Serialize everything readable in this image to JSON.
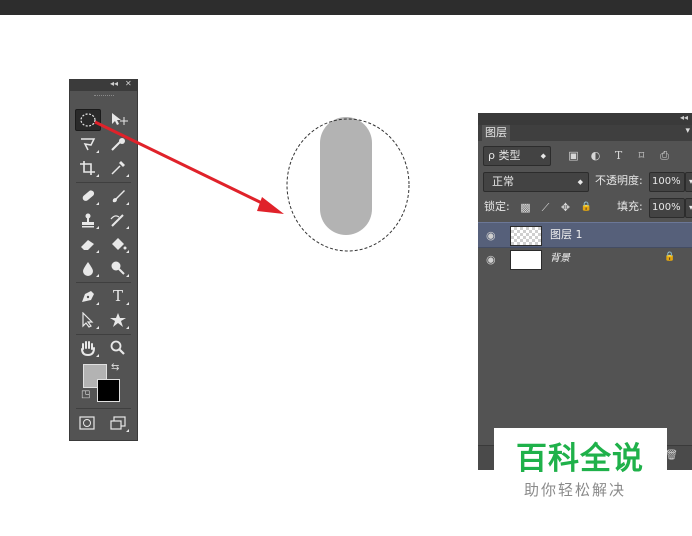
{
  "toolbox": {
    "collapse": "◂◂",
    "close": "✕",
    "tools": [
      {
        "name": "elliptical-marquee-tool",
        "glyph": "",
        "selected": true
      },
      {
        "name": "move-tool",
        "glyph": "▸✛"
      },
      {
        "name": "lasso-tool",
        "glyph": "ᗜ"
      },
      {
        "name": "quick-selection-tool",
        "glyph": "⟋"
      },
      {
        "name": "crop-tool",
        "glyph": "⌗"
      },
      {
        "name": "eyedropper-tool",
        "glyph": "⁄"
      },
      {
        "name": "healing-brush-tool",
        "glyph": "⌀"
      },
      {
        "name": "brush-tool",
        "glyph": "⟋"
      },
      {
        "name": "clone-stamp-tool",
        "glyph": "⊥"
      },
      {
        "name": "history-brush-tool",
        "glyph": "⤴"
      },
      {
        "name": "eraser-tool",
        "glyph": "▰"
      },
      {
        "name": "paint-bucket-tool",
        "glyph": "◆"
      },
      {
        "name": "blur-tool",
        "glyph": "●"
      },
      {
        "name": "dodge-tool",
        "glyph": "⚲"
      },
      {
        "name": "pen-tool",
        "glyph": "✒"
      },
      {
        "name": "type-tool",
        "glyph": "T"
      },
      {
        "name": "path-selection-tool",
        "glyph": "↖"
      },
      {
        "name": "shape-tool",
        "glyph": "✱"
      },
      {
        "name": "hand-tool",
        "glyph": "✋"
      },
      {
        "name": "zoom-tool",
        "glyph": "⚲"
      }
    ],
    "swap_glyph": "⇆",
    "default_glyph": "◳",
    "foreground_color": "#b3b3b3",
    "background_color": "#000000",
    "quickmask_glyph": "◙",
    "screenmode_glyph": "⧉"
  },
  "canvas": {
    "shape_color": "#b3b3b3",
    "selection": "dashed-ellipse",
    "arrow_color": "#e0222a"
  },
  "layers_panel": {
    "collapse": "◂◂",
    "tab_label": "图层",
    "menu_glyph": "▾",
    "filter_label": "ρ 类型",
    "filter_arrow": "◆",
    "filter_icons": [
      "▣",
      "◐",
      "T",
      "⌑",
      "⎙"
    ],
    "blend_mode": "正常",
    "blend_arrow": "◆",
    "opacity_label": "不透明度:",
    "opacity_value": "100%",
    "lock_label": "锁定:",
    "lock_icons": [
      "▩",
      "⟋",
      "✥",
      "🔒"
    ],
    "fill_label": "填充:",
    "fill_value": "100%",
    "dropdown_arrow": "▾",
    "layers": [
      {
        "name": "图层 1",
        "visible": true,
        "selected": true,
        "thumb": "transparent"
      },
      {
        "name": "背景",
        "visible": true,
        "selected": false,
        "thumb": "white",
        "locked": true
      }
    ],
    "eye_glyph": "◉",
    "lock_glyph": "🔒",
    "trash_glyph": "🗑"
  },
  "watermark": {
    "title": "百科全说",
    "subtitle": "助你轻松解决"
  }
}
